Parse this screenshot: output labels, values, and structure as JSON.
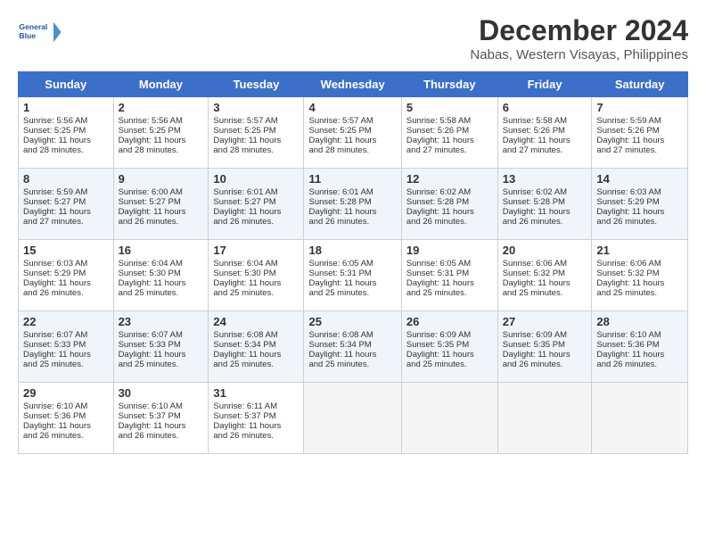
{
  "header": {
    "logo_line1": "General",
    "logo_line2": "Blue",
    "title": "December 2024",
    "subtitle": "Nabas, Western Visayas, Philippines"
  },
  "weekdays": [
    "Sunday",
    "Monday",
    "Tuesday",
    "Wednesday",
    "Thursday",
    "Friday",
    "Saturday"
  ],
  "weeks": [
    [
      {
        "day": 1,
        "sunrise": "5:56 AM",
        "sunset": "5:25 PM",
        "daylight": "11 hours and 28 minutes"
      },
      {
        "day": 2,
        "sunrise": "5:56 AM",
        "sunset": "5:25 PM",
        "daylight": "11 hours and 28 minutes"
      },
      {
        "day": 3,
        "sunrise": "5:57 AM",
        "sunset": "5:25 PM",
        "daylight": "11 hours and 28 minutes"
      },
      {
        "day": 4,
        "sunrise": "5:57 AM",
        "sunset": "5:25 PM",
        "daylight": "11 hours and 28 minutes"
      },
      {
        "day": 5,
        "sunrise": "5:58 AM",
        "sunset": "5:26 PM",
        "daylight": "11 hours and 27 minutes"
      },
      {
        "day": 6,
        "sunrise": "5:58 AM",
        "sunset": "5:26 PM",
        "daylight": "11 hours and 27 minutes"
      },
      {
        "day": 7,
        "sunrise": "5:59 AM",
        "sunset": "5:26 PM",
        "daylight": "11 hours and 27 minutes"
      }
    ],
    [
      {
        "day": 8,
        "sunrise": "5:59 AM",
        "sunset": "5:27 PM",
        "daylight": "11 hours and 27 minutes"
      },
      {
        "day": 9,
        "sunrise": "6:00 AM",
        "sunset": "5:27 PM",
        "daylight": "11 hours and 26 minutes"
      },
      {
        "day": 10,
        "sunrise": "6:01 AM",
        "sunset": "5:27 PM",
        "daylight": "11 hours and 26 minutes"
      },
      {
        "day": 11,
        "sunrise": "6:01 AM",
        "sunset": "5:28 PM",
        "daylight": "11 hours and 26 minutes"
      },
      {
        "day": 12,
        "sunrise": "6:02 AM",
        "sunset": "5:28 PM",
        "daylight": "11 hours and 26 minutes"
      },
      {
        "day": 13,
        "sunrise": "6:02 AM",
        "sunset": "5:28 PM",
        "daylight": "11 hours and 26 minutes"
      },
      {
        "day": 14,
        "sunrise": "6:03 AM",
        "sunset": "5:29 PM",
        "daylight": "11 hours and 26 minutes"
      }
    ],
    [
      {
        "day": 15,
        "sunrise": "6:03 AM",
        "sunset": "5:29 PM",
        "daylight": "11 hours and 26 minutes"
      },
      {
        "day": 16,
        "sunrise": "6:04 AM",
        "sunset": "5:30 PM",
        "daylight": "11 hours and 25 minutes"
      },
      {
        "day": 17,
        "sunrise": "6:04 AM",
        "sunset": "5:30 PM",
        "daylight": "11 hours and 25 minutes"
      },
      {
        "day": 18,
        "sunrise": "6:05 AM",
        "sunset": "5:31 PM",
        "daylight": "11 hours and 25 minutes"
      },
      {
        "day": 19,
        "sunrise": "6:05 AM",
        "sunset": "5:31 PM",
        "daylight": "11 hours and 25 minutes"
      },
      {
        "day": 20,
        "sunrise": "6:06 AM",
        "sunset": "5:32 PM",
        "daylight": "11 hours and 25 minutes"
      },
      {
        "day": 21,
        "sunrise": "6:06 AM",
        "sunset": "5:32 PM",
        "daylight": "11 hours and 25 minutes"
      }
    ],
    [
      {
        "day": 22,
        "sunrise": "6:07 AM",
        "sunset": "5:33 PM",
        "daylight": "11 hours and 25 minutes"
      },
      {
        "day": 23,
        "sunrise": "6:07 AM",
        "sunset": "5:33 PM",
        "daylight": "11 hours and 25 minutes"
      },
      {
        "day": 24,
        "sunrise": "6:08 AM",
        "sunset": "5:34 PM",
        "daylight": "11 hours and 25 minutes"
      },
      {
        "day": 25,
        "sunrise": "6:08 AM",
        "sunset": "5:34 PM",
        "daylight": "11 hours and 25 minutes"
      },
      {
        "day": 26,
        "sunrise": "6:09 AM",
        "sunset": "5:35 PM",
        "daylight": "11 hours and 25 minutes"
      },
      {
        "day": 27,
        "sunrise": "6:09 AM",
        "sunset": "5:35 PM",
        "daylight": "11 hours and 26 minutes"
      },
      {
        "day": 28,
        "sunrise": "6:10 AM",
        "sunset": "5:36 PM",
        "daylight": "11 hours and 26 minutes"
      }
    ],
    [
      {
        "day": 29,
        "sunrise": "6:10 AM",
        "sunset": "5:36 PM",
        "daylight": "11 hours and 26 minutes"
      },
      {
        "day": 30,
        "sunrise": "6:10 AM",
        "sunset": "5:37 PM",
        "daylight": "11 hours and 26 minutes"
      },
      {
        "day": 31,
        "sunrise": "6:11 AM",
        "sunset": "5:37 PM",
        "daylight": "11 hours and 26 minutes"
      },
      null,
      null,
      null,
      null
    ]
  ]
}
